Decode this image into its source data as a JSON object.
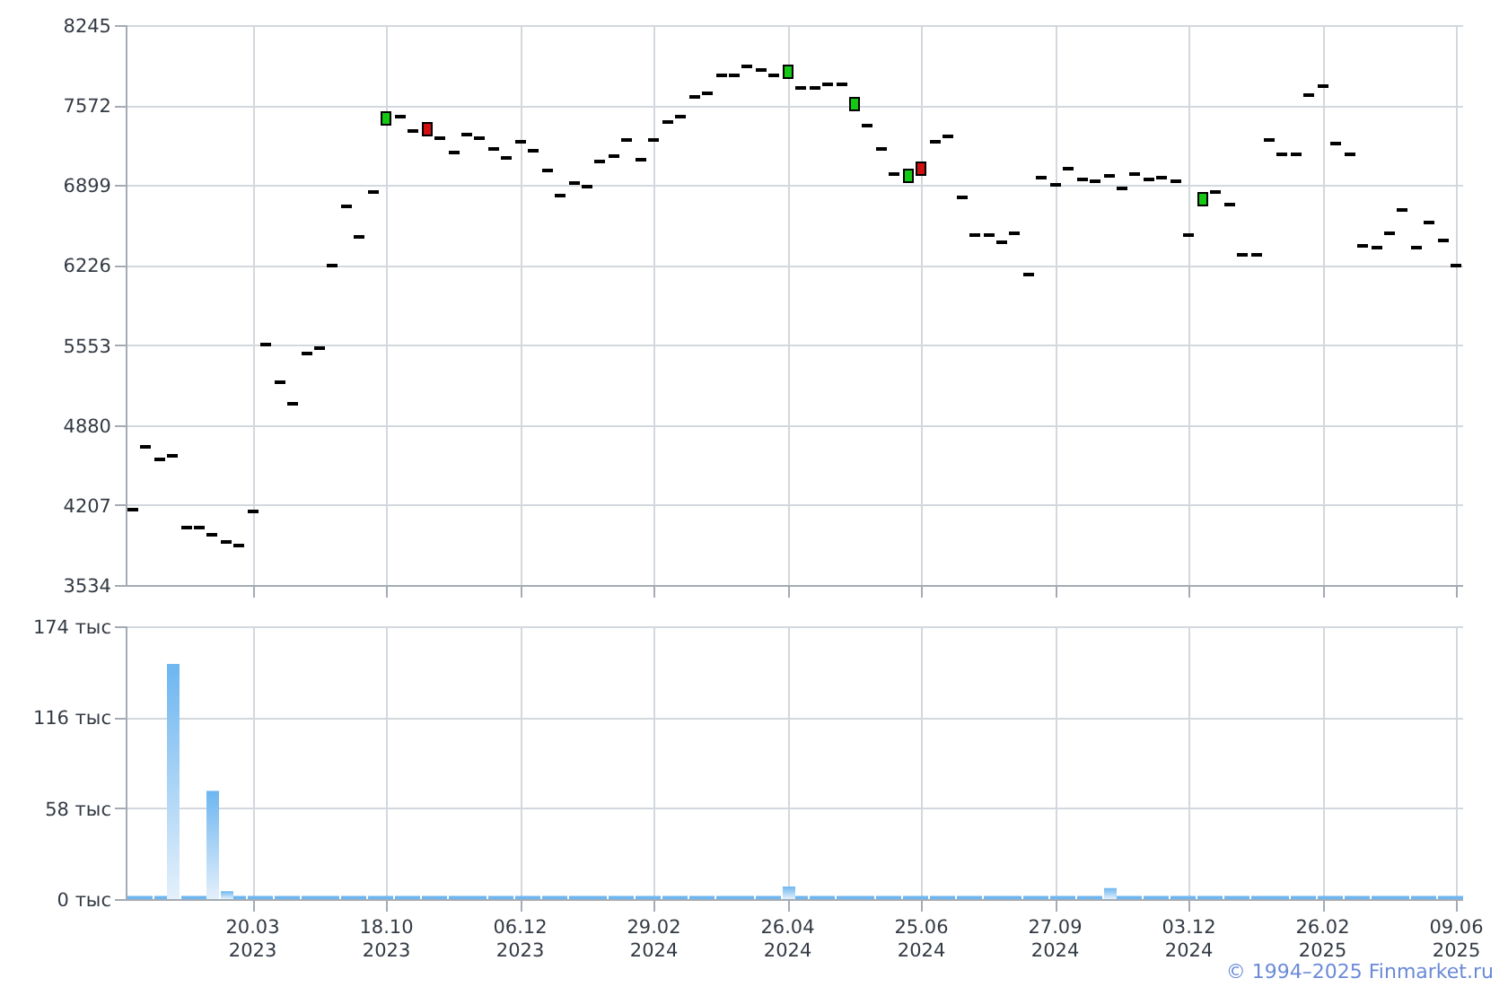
{
  "price": {
    "chart_data": {
      "type": "scatter",
      "ylim": [
        3534,
        8245
      ],
      "yticks": [
        {
          "value": 3534,
          "label": "3534"
        },
        {
          "value": 4207,
          "label": "4207"
        },
        {
          "value": 4880,
          "label": "4880"
        },
        {
          "value": 5553,
          "label": "5553"
        },
        {
          "value": 6226,
          "label": "6226"
        },
        {
          "value": 6899,
          "label": "6899"
        },
        {
          "value": 7572,
          "label": "7572"
        },
        {
          "value": 8245,
          "label": "8245"
        }
      ],
      "categories": [
        null,
        null,
        null,
        null,
        null,
        null,
        null,
        null,
        null,
        null,
        null,
        null,
        null,
        null,
        null,
        null,
        null,
        null,
        null,
        null,
        null,
        null,
        null,
        null,
        null,
        null,
        null,
        null,
        null,
        null,
        null,
        null,
        null,
        null,
        null,
        null,
        null,
        null,
        null,
        null,
        null,
        null,
        null,
        null,
        null,
        null,
        null,
        null,
        null,
        null,
        null,
        null,
        null,
        null,
        null,
        null,
        null,
        null,
        null,
        null,
        null,
        null,
        null,
        null,
        null,
        null,
        null,
        null,
        null,
        null,
        null,
        null,
        null,
        null,
        null,
        null,
        null,
        null,
        null,
        null,
        null,
        null,
        null,
        null,
        null,
        null,
        null,
        null,
        null,
        null,
        null,
        null,
        null,
        null,
        null,
        null,
        null,
        null,
        null,
        null
      ],
      "series": [
        {
          "color": "#000000",
          "values": [
            4168,
            4696,
            4591,
            4621,
            4017,
            4017,
            3957,
            3896,
            3866,
            4153,
            5557,
            5240,
            5059,
            5482,
            5527,
            6222,
            6720,
            6463,
            6841,
            null,
            7475,
            7354,
            null,
            7294,
            7173,
            7324,
            7294,
            7203,
            7128,
            7264,
            7188,
            7022,
            6811,
            6916,
            6886,
            7097,
            7143,
            7279,
            7113,
            7279,
            7430,
            7475,
            7641,
            7671,
            7822,
            7822,
            7898,
            7868,
            7822,
            null,
            7717,
            7717,
            7747,
            7747,
            null,
            7399,
            7203,
            6992,
            null,
            null,
            7264,
            7309,
            6795,
            6478,
            6478,
            6418,
            6493,
            6146,
            6962,
            6901,
            7037,
            6946,
            6931,
            6977,
            6871,
            6992,
            6946,
            6961,
            6931,
            6478,
            null,
            6841,
            6735,
            6312,
            6312,
            7279,
            7158,
            7158,
            7656,
            7732,
            7248,
            7158,
            6388,
            6373,
            6493,
            6690,
            6373,
            6584,
            6433,
            6222
          ]
        },
        {
          "color": "#14c814",
          "values": [
            null,
            null,
            null,
            null,
            null,
            null,
            null,
            null,
            null,
            null,
            null,
            null,
            null,
            null,
            null,
            null,
            null,
            null,
            null,
            7460,
            null,
            null,
            null,
            null,
            null,
            null,
            null,
            null,
            null,
            null,
            null,
            null,
            null,
            null,
            null,
            null,
            null,
            null,
            null,
            null,
            null,
            null,
            null,
            null,
            null,
            null,
            null,
            null,
            null,
            7853,
            null,
            null,
            null,
            null,
            7588,
            null,
            null,
            null,
            6977,
            null,
            null,
            null,
            null,
            null,
            null,
            null,
            null,
            null,
            null,
            null,
            null,
            null,
            null,
            null,
            null,
            null,
            null,
            null,
            null,
            null,
            6773,
            null,
            null,
            null,
            null,
            null,
            null,
            null,
            null,
            null,
            null,
            null,
            null,
            null,
            null,
            null,
            null,
            null,
            null,
            null
          ]
        },
        {
          "color": "#d01010",
          "values": [
            null,
            null,
            null,
            null,
            null,
            null,
            null,
            null,
            null,
            null,
            null,
            null,
            null,
            null,
            null,
            null,
            null,
            null,
            null,
            null,
            null,
            null,
            7370,
            null,
            null,
            null,
            null,
            null,
            null,
            null,
            null,
            null,
            null,
            null,
            null,
            null,
            null,
            null,
            null,
            null,
            null,
            null,
            null,
            null,
            null,
            null,
            null,
            null,
            null,
            null,
            null,
            null,
            null,
            null,
            null,
            null,
            null,
            null,
            null,
            7037,
            null,
            null,
            null,
            null,
            null,
            null,
            null,
            null,
            null,
            null,
            null,
            null,
            null,
            null,
            null,
            null,
            null,
            null,
            null,
            null,
            null,
            null,
            null,
            null,
            null,
            null,
            null,
            null,
            null,
            null,
            null,
            null,
            null,
            null,
            null,
            null,
            null,
            null,
            null,
            null
          ]
        }
      ],
      "grid": true
    }
  },
  "volume": {
    "chart_data": {
      "type": "bar",
      "ylim": [
        0,
        174
      ],
      "yticks": [
        {
          "value": 0,
          "label": "0 тыс"
        },
        {
          "value": 58,
          "label": "58 тыс"
        },
        {
          "value": 116,
          "label": "116 тыс"
        },
        {
          "value": 174,
          "label": "174 тыс"
        }
      ],
      "categories": [
        null,
        null,
        null,
        null,
        null,
        null,
        null,
        null,
        null,
        "20.03\n2023",
        null,
        null,
        null,
        null,
        null,
        null,
        null,
        null,
        null,
        "18.10\n2023",
        null,
        null,
        null,
        null,
        null,
        null,
        null,
        null,
        null,
        "06.12\n2023",
        null,
        null,
        null,
        null,
        null,
        null,
        null,
        null,
        null,
        "29.02\n2024",
        null,
        null,
        null,
        null,
        null,
        null,
        null,
        null,
        null,
        "26.04\n2024",
        null,
        null,
        null,
        null,
        null,
        null,
        null,
        null,
        null,
        "25.06\n2024",
        null,
        null,
        null,
        null,
        null,
        null,
        null,
        null,
        null,
        "27.09\n2024",
        null,
        null,
        null,
        null,
        null,
        null,
        null,
        null,
        null,
        "03.12\n2024",
        null,
        null,
        null,
        null,
        null,
        null,
        null,
        null,
        null,
        "26.02\n2025",
        null,
        null,
        null,
        null,
        null,
        null,
        null,
        null,
        null,
        "09.06\n2025"
      ],
      "series": [
        {
          "color": "#6db6f0",
          "values": [
            2,
            2,
            2,
            150,
            2,
            2,
            69,
            5,
            2,
            2,
            2,
            2,
            2,
            2,
            2,
            2,
            2,
            2,
            2,
            2,
            2,
            2,
            2,
            2,
            2,
            2,
            2,
            2,
            2,
            2,
            2,
            2,
            2,
            2,
            2,
            2,
            2,
            2,
            2,
            2,
            2,
            2,
            2,
            2,
            2,
            2,
            2,
            2,
            2,
            8,
            2,
            2,
            2,
            2,
            2,
            2,
            2,
            2,
            2,
            2,
            2,
            2,
            2,
            2,
            2,
            2,
            2,
            2,
            2,
            2,
            2,
            2,
            2,
            7,
            2,
            2,
            2,
            2,
            2,
            2,
            2,
            2,
            2,
            2,
            2,
            2,
            2,
            2,
            2,
            2,
            2,
            2,
            2,
            2,
            2,
            2,
            2,
            2,
            2,
            2
          ]
        }
      ],
      "grid": true
    }
  },
  "footer": {
    "copyright": "© 1994–2025 Finmarket.ru"
  }
}
